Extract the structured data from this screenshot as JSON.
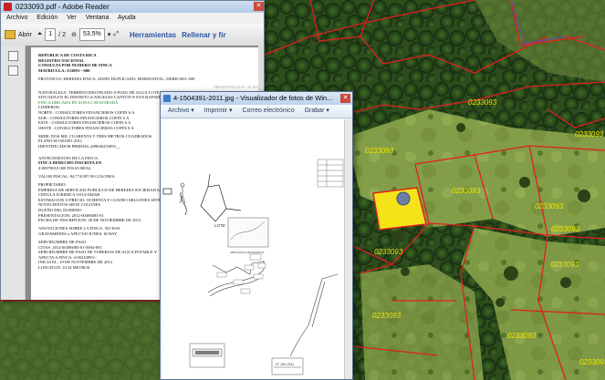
{
  "map": {
    "parcel_labels": [
      "0233093",
      "0233093",
      "0233093",
      "0233093",
      "0233093",
      "0233093",
      "0233093",
      "0233093",
      "0233093",
      "0233093",
      "0233093",
      "0233093"
    ],
    "colors": {
      "parcel_line": "#e02020",
      "selected_parcel": "#f5e31a",
      "label": "#f2e600"
    }
  },
  "reader": {
    "title": "0233093.pdf - Adobe Reader",
    "menu": [
      "Archivo",
      "Edición",
      "Ver",
      "Ventana",
      "Ayuda"
    ],
    "toolbar": {
      "open": "Abrir",
      "page_current": "1",
      "page_total": "/ 2",
      "zoom": "53.5%",
      "tools": "Herramientas",
      "fill": "Rellenar y fir"
    },
    "doc_lines": [
      "REPUBLICA DE COSTA RICA",
      "REGISTRO NACIONAL",
      "CONSULTA POR NUMERO DE FINCA",
      "MATRICULA: 233093---000",
      "",
      "PROVINCIA: HEREDIA FINCA: 233093 DUPLICADO: HORIZONTAL: DERECHO: 000",
      "",
      "NATURALEZA: TERRENO DESTINADO A POZO DE AGUA LOTE",
      "SITUADA EN EL DISTRITO 4-ANGELES CANTON 9-SAN RAFAEL",
      "FINCA UBICADA EN ZONA CATASTRADA",
      "LINDEROS:",
      "  NORTE : CONSULTORES FINANCIEROS COFIN S A",
      "  SUR : CONSULTORES FINANCIEROS COFIN S A",
      "  ESTE : CONSULTORES FINANCIEROS COFIN S A",
      "  OESTE : CONSULTORES FINANCIEROS COFIN S A",
      "",
      "MIDE: DOS MIL CUARENTA Y TRES METROS CUADRADOS",
      "PLANO:H-1504391-2011",
      "IDENTIFICADOR PREDIAL:409040233093__",
      "",
      "",
      "ANTECEDENTES DE LA FINCA:",
      "  FINCA  DERECHO INSCRITA EN",
      "  4-00070010  000  FOLIO REAL",
      "",
      "VALOR FISCAL: 84,774,907.00 COLONES",
      "",
      "PROPIETARIO:",
      "EMPRESA DE SERVICIOS PUBLICOS DE HEREDIA SOCIEDAD A",
      "CEDULA JURIDICA 3-014-042028",
      "ESTIMACION O PRECIO: OCHENTA Y CUATRO MILLONES SETE",
      "NOVECIENTOS SIETE COLONES",
      "DUEÑO DEL DOMINIO",
      "PRESENTACION: 2012-00496085-01",
      "FECHA DE INSCRIPCION: 28 DE NOVIEMBRE DE 2012",
      "",
      "ANOTACIONES SOBRE LA FINCA: NO HAY",
      "GRAVAMENES o AFECTACIONES: SI HAY",
      "",
      "SERVIDUMBRE DE PASO",
      "CITAS: 2012-00496085-01-0004-001",
      "SERVIDUMBRE DE PASO DE TUBERIAS DE AGUA POTABLE Y",
      "AFECTA A FINCA: 4-00233093--",
      "INICIA EL: 19 DE NOVIEMBRE DE 2012",
      "LONGITUD: 10.34 METROS"
    ],
    "faint_header": "PRESENTACION: 20 HAY"
  },
  "viewer": {
    "title": "4-1504391-2011.jpg - Visualizador de fotos de Win...",
    "menu": [
      "Archivo ▾",
      "Imprimir ▾",
      "Correo electrónico",
      "Grabar ▾"
    ],
    "plan_labels": {
      "lote": "LOTE",
      "ubicacion": "UBICACION GEOGRAFICA",
      "stamp": "07 JUN 2011"
    }
  }
}
